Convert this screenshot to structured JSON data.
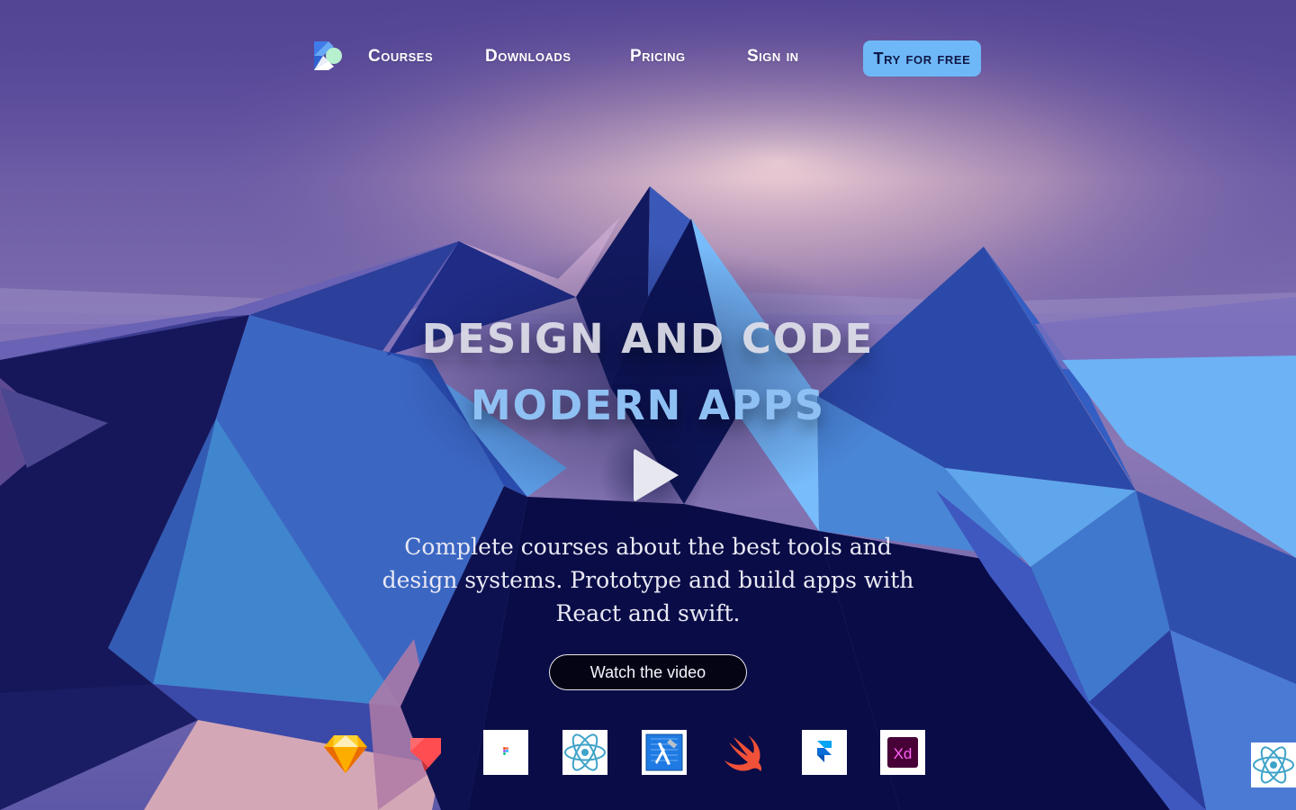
{
  "nav": {
    "logo_icon": "kotlin-like-logo-icon",
    "links": [
      {
        "label": "Courses"
      },
      {
        "label": "Downloads"
      },
      {
        "label": "Pricing"
      },
      {
        "label": "Sign in"
      }
    ],
    "cta_label": "Try for free"
  },
  "hero": {
    "title_line1": "DESIGN AND CODE",
    "title_line2": "MODERN APPS",
    "play_icon": "play-icon",
    "description": "Complete courses about the best tools and design systems. Prototype and build apps with React and swift.",
    "watch_button": "Watch the video"
  },
  "tools": [
    {
      "name": "sketch-icon"
    },
    {
      "name": "invision-studio-icon"
    },
    {
      "name": "figma-icon"
    },
    {
      "name": "react-icon"
    },
    {
      "name": "xcode-icon"
    },
    {
      "name": "swift-icon"
    },
    {
      "name": "framer-icon"
    },
    {
      "name": "adobe-xd-icon"
    },
    {
      "name": "react-icon"
    }
  ],
  "colors": {
    "accent": "#6fb8f7",
    "title_highlight": "#8fc0f3",
    "cta_text": "#0e1746",
    "dark_button": "#050414"
  }
}
